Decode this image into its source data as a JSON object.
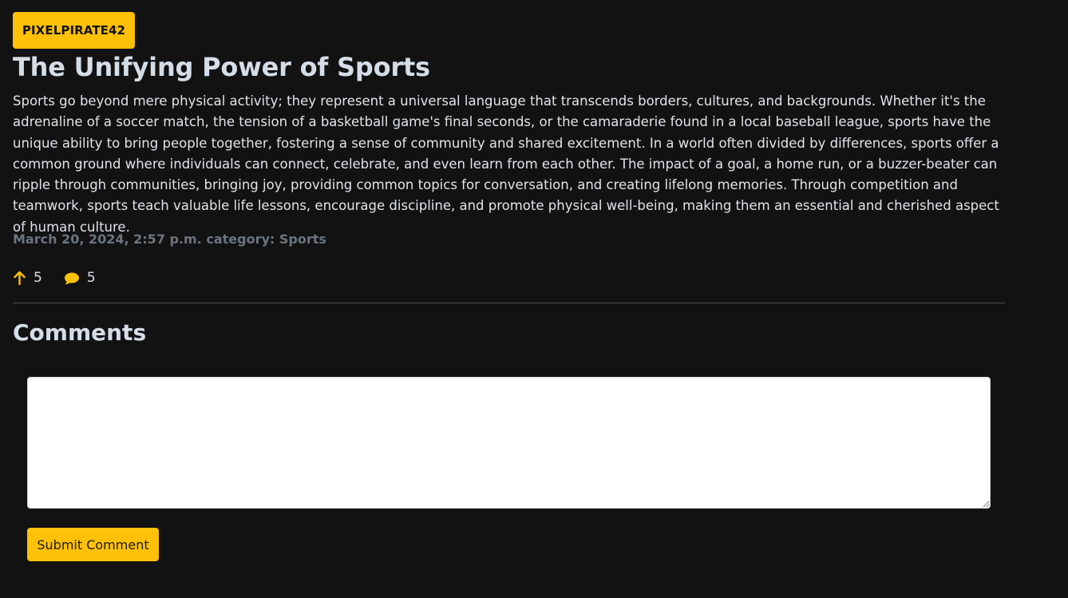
{
  "post": {
    "author": "PIXELPIRATE42",
    "title": "The Unifying Power of Sports",
    "body": "Sports go beyond mere physical activity; they represent a universal language that transcends borders, cultures, and backgrounds. Whether it's the adrenaline of a soccer match, the tension of a basketball game's final seconds, or the camaraderie found in a local baseball league, sports have the unique ability to bring people together, fostering a sense of community and shared excitement. In a world often divided by differences, sports offer a common ground where individuals can connect, celebrate, and even learn from each other. The impact of a goal, a home run, or a buzzer-beater can ripple through communities, bringing joy, providing common topics for conversation, and creating lifelong memories. Through competition and teamwork, sports teach valuable life lessons, encourage discipline, and promote physical well-being, making them an essential and cherished aspect of human culture.",
    "meta": "March 20, 2024, 2:57 p.m. category: Sports",
    "upvotes": "5",
    "comment_count": "5"
  },
  "icons": {
    "upvote": "arrow-up-icon",
    "comments": "chat-bubble-icon"
  },
  "comments_section": {
    "heading": "Comments",
    "input_value": "",
    "submit_label": "Submit Comment"
  },
  "colors": {
    "background": "#121212",
    "accent": "#ffc107",
    "muted": "#6c757d",
    "text": "#dde3ea"
  }
}
